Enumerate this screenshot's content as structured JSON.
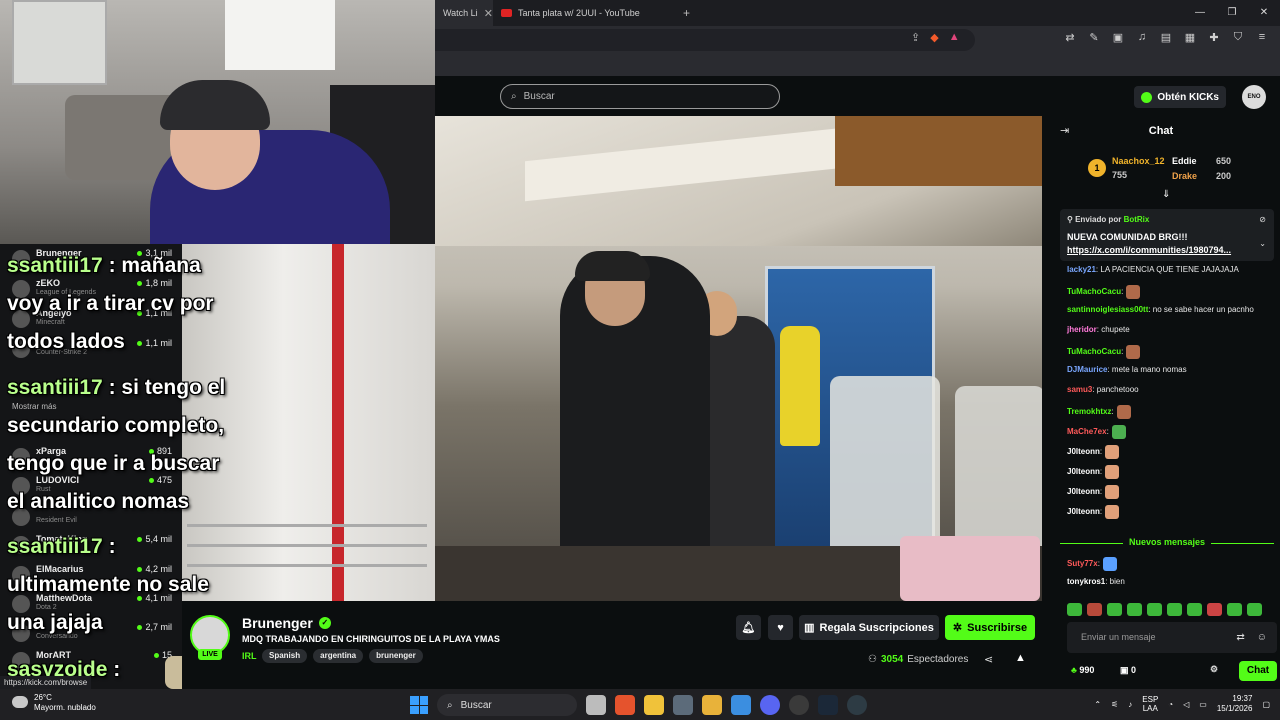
{
  "browser": {
    "tabs": [
      {
        "label": "Watch Li"
      },
      {
        "label": "Tanta plata w/ 2UUI - YouTube"
      }
    ],
    "new_tab": "+"
  },
  "header": {
    "search_placeholder": "Buscar",
    "kicks_button": "Obtén KICKs",
    "avatar_text": "ENO"
  },
  "sidebar": {
    "items": [
      {
        "name": "Brunenger",
        "category": "",
        "viewers": "3,1 mil"
      },
      {
        "name": "zEKO",
        "category": "League of Legends",
        "viewers": "1,8 mil"
      },
      {
        "name": "Angelyo",
        "category": "Minecraft",
        "viewers": "1,1 mil"
      },
      {
        "name": "",
        "category": "Counter-Strike 2",
        "viewers": "1,1 mil"
      }
    ],
    "show_more": "Mostrar más",
    "items2": [
      {
        "name": "xParga",
        "category": "",
        "viewers": "891"
      },
      {
        "name": "LUDOVICI",
        "category": "Rust",
        "viewers": "475"
      },
      {
        "name": "",
        "category": "Resident Evil",
        "viewers": ""
      },
      {
        "name": "TomateKing",
        "category": "",
        "viewers": "5,4 mil"
      },
      {
        "name": "ElMacarius",
        "category": "",
        "viewers": "4,2 mil"
      },
      {
        "name": "MatthewDota",
        "category": "Dota 2",
        "viewers": "4,1 mil"
      },
      {
        "name": "",
        "category": "Conversando",
        "viewers": "2,7 mil"
      },
      {
        "name": "MorART",
        "category": "",
        "viewers": "15"
      }
    ]
  },
  "overlay": {
    "msg1_user": "ssantiii17",
    "msg1_line1": " : mañana",
    "msg1_line2": "voy a ir a tirar cv por",
    "msg1_line3": "todos lados",
    "msg2_user": "ssantiii17",
    "msg2_line1": " : si tengo el",
    "msg2_line2": "secundario completo,",
    "msg2_line3": "tengo que ir a buscar",
    "msg2_line4": "el analitico nomas",
    "msg3_user": "ssantiii17",
    "msg3_line1": " :",
    "msg3_line2": "ultimamente no sale",
    "msg3_line3": "una jajaja",
    "msg4_user": "sasyzoide",
    "msg4_line1": " :"
  },
  "stream": {
    "channel": "Brunenger",
    "live": "LIVE",
    "title": "MDQ TRABAJANDO EN CHIRINGUITOS DE LA PLAYA YMAS",
    "category": "IRL",
    "tags": [
      "Spanish",
      "argentina",
      "brunenger"
    ],
    "gift_button": "Regala Suscripciones",
    "subscribe_button": "Suscribirse",
    "viewers_count": "3054",
    "viewers_label": "Espectadores"
  },
  "chat": {
    "title": "Chat",
    "leaderboard": {
      "first_name": "Naachox_12",
      "first_value": "755",
      "second_name": "Eddie",
      "second_value": "650",
      "third_name": "Drake",
      "third_value": "200"
    },
    "pinned": {
      "sent_by": "Enviado por",
      "bot": "BotRix",
      "message": "NUEVA COMUNIDAD BRG!!!",
      "link": "https://x.com/i/communities/1980794..."
    },
    "messages": [
      {
        "user": "lacky21",
        "color": "#7aa7ff",
        "text": ": LA PACIENCIA QUE TIENE JAJAJAJA",
        "emote": ""
      },
      {
        "user": "TuMachoCacu",
        "color": "#53fc18",
        "text": ":",
        "emote": "#b06a4a"
      },
      {
        "user": "santinnoiglesiass00tt",
        "color": "#53fc18",
        "text": ": no se sabe hacer un pacnho",
        "emote": ""
      },
      {
        "user": "jheridor",
        "color": "#ff7ad9",
        "text": ": chupete",
        "emote": ""
      },
      {
        "user": "TuMachoCacu",
        "color": "#53fc18",
        "text": ":",
        "emote": "#b06a4a"
      },
      {
        "user": "DJMaurice",
        "color": "#7aa7ff",
        "text": ": mete la mano nomas",
        "emote": ""
      },
      {
        "user": "samu3",
        "color": "#ff5a5a",
        "text": ": panchetooo",
        "emote": ""
      },
      {
        "user": "Tremokhtxz",
        "color": "#53fc18",
        "text": ":",
        "emote": "#b06a4a"
      },
      {
        "user": "MaChe7ex",
        "color": "#ff5a5a",
        "text": ":",
        "emote": "#4caf50"
      },
      {
        "user": "J0lteonn",
        "color": "#ffffff",
        "text": ":",
        "emote": "#e0a07a"
      },
      {
        "user": "J0lteonn",
        "color": "#ffffff",
        "text": ":",
        "emote": "#e0a07a"
      },
      {
        "user": "J0lteonn",
        "color": "#ffffff",
        "text": ":",
        "emote": "#e0a07a"
      },
      {
        "user": "J0lteonn",
        "color": "#ffffff",
        "text": ":",
        "emote": "#e0a07a"
      }
    ],
    "new_messages": "Nuevos mensajes",
    "messages2": [
      {
        "user": "Suty77x",
        "color": "#ff5a5a",
        "text": ":",
        "emote": "#5aa0ff"
      },
      {
        "user": "tonykros1",
        "color": "#ffffff",
        "text": ": bien",
        "emote": ""
      }
    ],
    "input_placeholder": "Enviar un mensaje",
    "points": "990",
    "boxes": "0",
    "send_button": "Chat"
  },
  "status_url": "https://kick.com/browse",
  "taskbar": {
    "temp": "26°C",
    "weather": "Mayorm. nublado",
    "search": "Buscar",
    "lang1": "ESP",
    "lang2": "LAA",
    "time": "19:37",
    "date": "15/1/2026"
  },
  "colors": {
    "accent": "#53fc18",
    "background": "#0b0e0f"
  }
}
